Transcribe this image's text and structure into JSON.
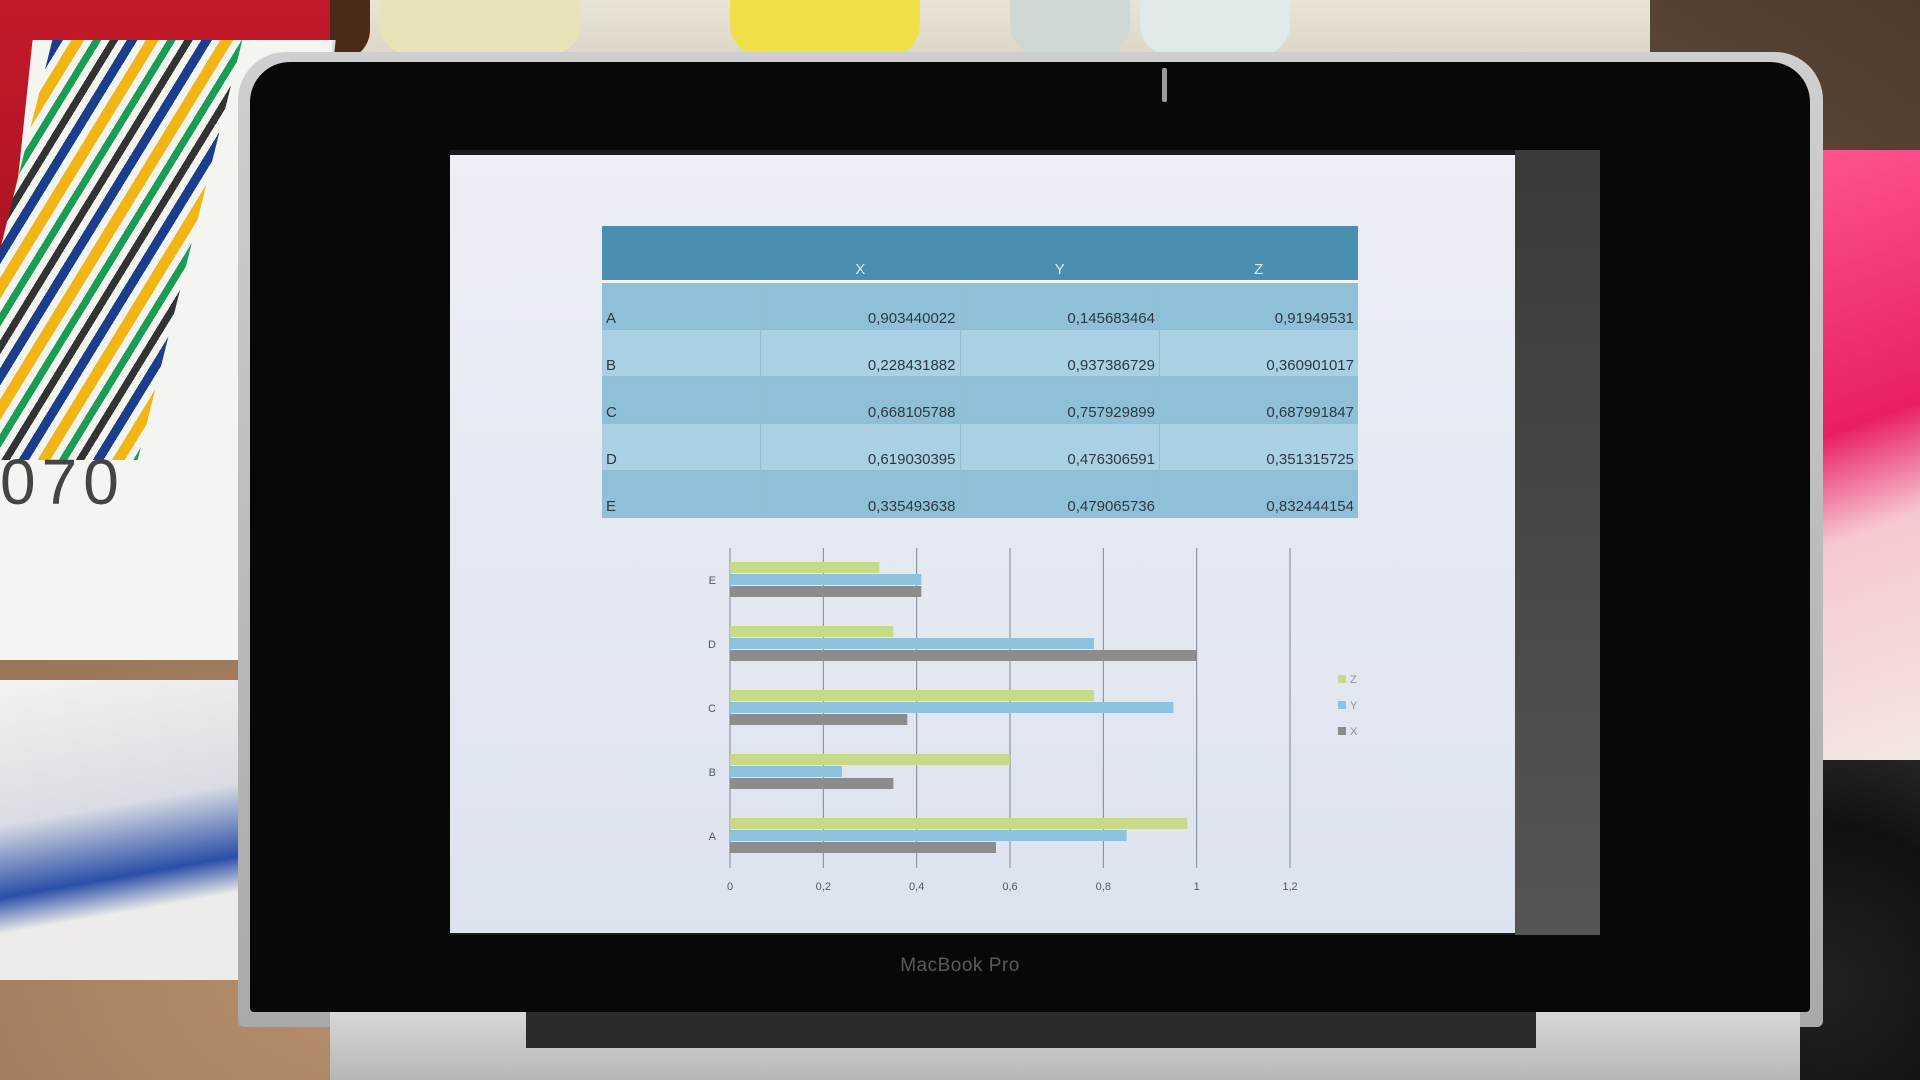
{
  "device": {
    "brand_label": "MacBook Pro"
  },
  "background": {
    "barcode_digits": "070"
  },
  "slide": {
    "table": {
      "columns": [
        "X",
        "Y",
        "Z"
      ],
      "rows": [
        {
          "label": "A",
          "values": [
            "0,903440022",
            "0,145683464",
            "0,91949531"
          ]
        },
        {
          "label": "B",
          "values": [
            "0,228431882",
            "0,937386729",
            "0,360901017"
          ]
        },
        {
          "label": "C",
          "values": [
            "0,668105788",
            "0,757929899",
            "0,687991847"
          ]
        },
        {
          "label": "D",
          "values": [
            "0,619030395",
            "0,476306591",
            "0,351315725"
          ]
        },
        {
          "label": "E",
          "values": [
            "0,335493638",
            "0,479065736",
            "0,832444154"
          ]
        }
      ]
    }
  },
  "chart_data": {
    "type": "bar",
    "orientation": "horizontal",
    "categories": [
      "A",
      "B",
      "C",
      "D",
      "E"
    ],
    "series": [
      {
        "name": "X",
        "values": [
          0.57,
          0.35,
          0.38,
          1.0,
          0.41
        ],
        "color": "#8c8c8c"
      },
      {
        "name": "Y",
        "values": [
          0.85,
          0.24,
          0.95,
          0.78,
          0.41
        ],
        "color": "#8ec3e0"
      },
      {
        "name": "Z",
        "values": [
          0.98,
          0.6,
          0.78,
          0.35,
          0.32
        ],
        "color": "#c9d98a"
      }
    ],
    "xlim": [
      0,
      1.2
    ],
    "xticks": [
      "0",
      "0,2",
      "0,4",
      "0,6",
      "0,8",
      "1",
      "1,2"
    ],
    "grid": true,
    "legend_position": "right"
  }
}
